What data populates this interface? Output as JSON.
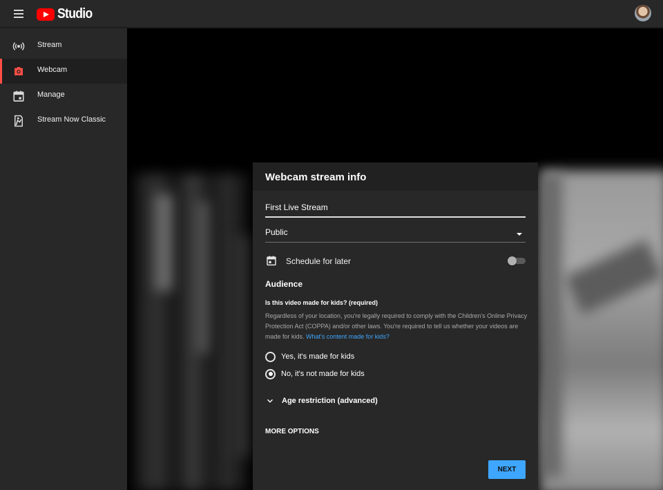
{
  "app": {
    "brand": "Studio",
    "logo_icon": "youtube-play-icon",
    "menu_icon": "hamburger-menu-icon",
    "avatar_icon": "user-avatar-icon"
  },
  "sidebar": {
    "items": [
      {
        "label": "Stream",
        "icon": "broadcast-icon",
        "active": false
      },
      {
        "label": "Webcam",
        "icon": "camera-icon",
        "active": true
      },
      {
        "label": "Manage",
        "icon": "calendar-icon",
        "active": false
      },
      {
        "label": "Stream Now Classic",
        "icon": "stream-now-classic-icon",
        "active": false
      }
    ]
  },
  "dialog": {
    "title": "Webcam stream info",
    "title_field_value": "First Live Stream",
    "privacy_value": "Public",
    "schedule_label": "Schedule for later",
    "schedule_enabled": false,
    "audience_heading": "Audience",
    "kids_question": "Is this video made for kids? (required)",
    "kids_description": "Regardless of your location, you're legally required to comply with the Children's Online Privacy Protection Act (COPPA) and/or other laws. You're required to tell us whether your videos are made for kids.",
    "kids_link": "What's content made for kids?",
    "radio_options": [
      {
        "label": "Yes, it's made for kids",
        "checked": false
      },
      {
        "label": "No, it's not made for kids",
        "checked": true
      }
    ],
    "age_restriction_label": "Age restriction (advanced)",
    "more_options_label": "MORE OPTIONS",
    "next_label": "NEXT"
  },
  "colors": {
    "accent_red": "#ff0000",
    "active_indicator": "#ff4e45",
    "link_blue": "#3ea6ff",
    "next_button": "#3ea6ff"
  }
}
